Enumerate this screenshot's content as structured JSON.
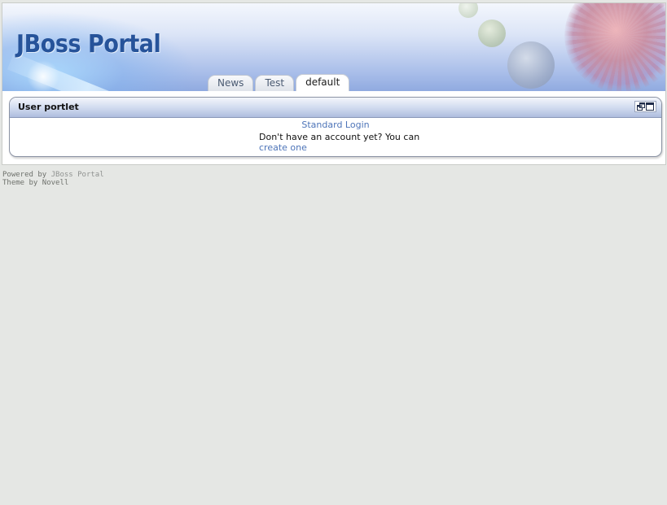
{
  "header": {
    "logo_text": "JBoss Portal"
  },
  "tabs": [
    {
      "label": "News",
      "active": false
    },
    {
      "label": "Test",
      "active": false
    },
    {
      "label": "default",
      "active": true
    }
  ],
  "portlet": {
    "title": "User portlet",
    "controls": [
      "restore-icon",
      "maximize-icon"
    ],
    "login_link": "Standard Login",
    "account_text": "Don't have an account yet? You can",
    "create_link": "create one"
  },
  "footer": {
    "powered_prefix": "Powered by",
    "powered_link": "JBoss Portal",
    "theme_prefix": "Theme by",
    "theme_link": "Novell"
  },
  "colors": {
    "link": "#4d74b8",
    "logo": "#26539a",
    "page_background": "#e5e7e4"
  }
}
